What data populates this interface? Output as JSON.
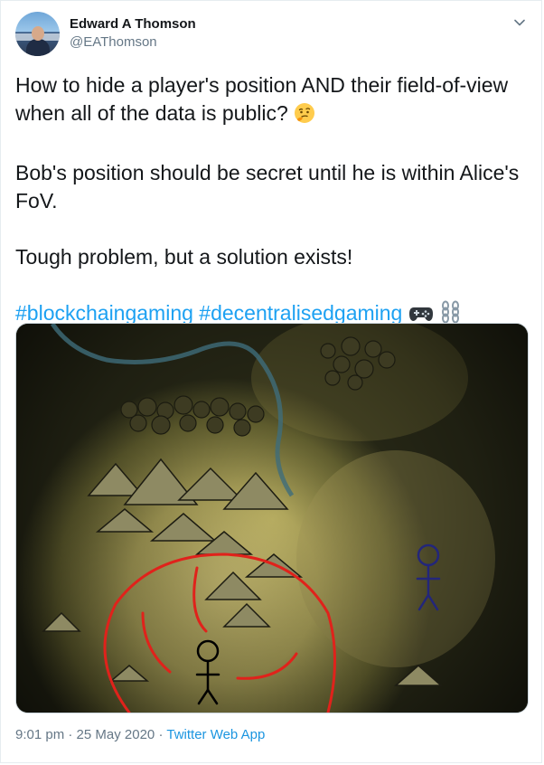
{
  "author": {
    "name": "Edward A Thomson",
    "handle": "@EAThomson"
  },
  "tweet": {
    "line1": "How to hide a player's position AND their field-of-view when all of the data is public?",
    "line2": "Bob's position should be secret until he is within Alice's FoV.",
    "line3": "Tough problem, but a solution exists!",
    "hashtag1": "#blockchaingaming",
    "hashtag2": "#decentralisedgaming"
  },
  "icons": {
    "thinking_emoji": "thinking-face",
    "controller_emoji": "video-game",
    "chain_emoji": "chains"
  },
  "footer": {
    "time": "9:01 pm",
    "date": "25 May 2020",
    "separator": "·",
    "app": "Twitter Web App"
  },
  "colors": {
    "hashtag": "#1da1f2",
    "muted": "#657786",
    "fov_circle": "#e0221b",
    "bob": "#23267a"
  }
}
